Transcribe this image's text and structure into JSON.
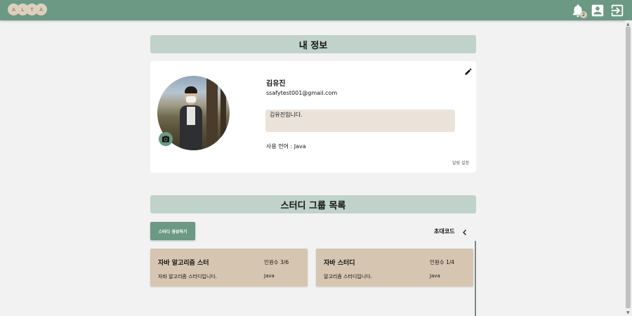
{
  "header": {
    "logo_letters": [
      "A",
      "L",
      "T",
      "A"
    ],
    "notification_count": "2",
    "icons": [
      "bell-icon",
      "account-box-icon",
      "logout-icon"
    ]
  },
  "profile": {
    "section_title": "내 정보",
    "name": "김유진",
    "email": "ssafytest001@gmail.com",
    "bio": "김유진입니다.",
    "language": "사용 언어 : Java",
    "alarm_setting": "알림 설정"
  },
  "studies": {
    "section_title": "스터디 그룹 목록",
    "create_button": "스터디 생성하기",
    "invite_code": "초대코드",
    "cards": [
      {
        "name": "자바 알고리즘 스터",
        "count": "인원수 3/6",
        "description": "자바 알고리즘 스터디입니다.",
        "language": "Java"
      },
      {
        "name": "자바 스터디",
        "count": "인원수 1/4",
        "description": "알고리즘 스터디입니다.",
        "language": "Java"
      }
    ]
  },
  "colors": {
    "topbar": "#6b9983",
    "section_header": "#bfd3ca",
    "card": "#d6c6b1",
    "bio_box": "#ebe3da",
    "logo_circle": "#ddd0bd"
  }
}
